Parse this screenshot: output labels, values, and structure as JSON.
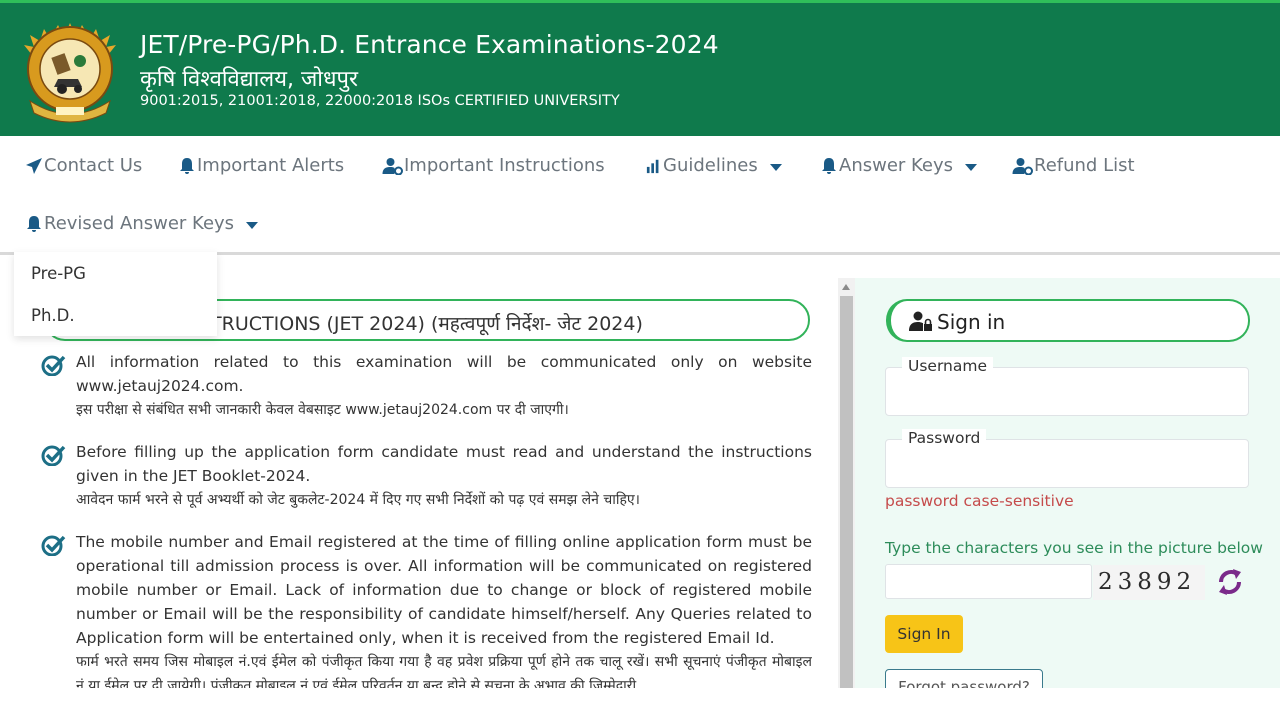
{
  "header": {
    "title": "JET/Pre-PG/Ph.D. Entrance Examinations-2024",
    "subtitle": "कृषि विश्वविद्यालय, जोधपुर",
    "iso": "9001:2015, 21001:2018, 22000:2018 ISOs CERTIFIED UNIVERSITY"
  },
  "nav": {
    "items": [
      {
        "label": "Contact Us",
        "icon": "paper-plane-icon"
      },
      {
        "label": "Important Alerts",
        "icon": "bell-icon"
      },
      {
        "label": "Important Instructions",
        "icon": "user-gear-icon"
      },
      {
        "label": "Guidelines",
        "icon": "bar-chart-icon"
      },
      {
        "label": "Answer Keys",
        "icon": "bell-icon"
      },
      {
        "label": "Refund List",
        "icon": "user-gear-icon"
      },
      {
        "label": "Revised Answer Keys",
        "icon": "bell-icon"
      }
    ],
    "dropdown": [
      "Pre-PG",
      "Ph.D."
    ]
  },
  "instructions": {
    "heading": "STRUCTIONS (JET 2024) (महत्वपूर्ण निर्देश- जेट 2024)",
    "items": [
      {
        "en": "All information related to this examination will be communicated only on website www.jetauj2024.com.",
        "hi": "इस परीक्षा से संबंधित सभी जानकारी केवल वेबसाइट www.jetauj2024.com पर दी जाएगी।"
      },
      {
        "en": "Before filling up the application form candidate must read and understand the instructions given in the JET Booklet-2024.",
        "hi": "आवेदन फार्म भरने से पूर्व अभ्यर्थी को जेट बुकलेट-2024 में दिए गए सभी निर्देशों को पढ़ एवं समझ लेने चाहिए।"
      },
      {
        "en": "The mobile number and Email registered at the time of filling online application form must be operational till admission process is over. All information will be communicated on registered mobile number or Email. Lack of information due to change or block of registered mobile number or Email will be the responsibility of candidate himself/herself. Any Queries related to Application form will be entertained only, when it is received from the registered Email Id.",
        "hi": "फार्म भरते समय जिस मोबाइल नं.एवं ईमेल को पंजीकृत किया गया है वह प्रवेश प्रक्रिया पूर्ण होने तक चालू रखें। सभी सूचनाएं पंजीकृत मोबाइल नं.या ईमेल पर दी जायेगी। पंजीकृत मोबाइल नं.एवं ईमेल परिवर्तन या बन्द होने से सूचना के अभाव की जिम्मेदारी"
      }
    ]
  },
  "signin": {
    "heading": "Sign in",
    "username_label": "Username",
    "username_value": "",
    "password_label": "Password",
    "password_value": "",
    "password_note": "password case-sensitive",
    "captcha_prompt": "Type the characters you see in the picture below",
    "captcha_value": "",
    "captcha_text": "23892",
    "submit": "Sign In",
    "forgot": "Forgot password?"
  },
  "colors": {
    "header_bg": "#0f7a4c",
    "accent_green": "#32b35a",
    "nav_text": "#6c757d",
    "icon_blue": "#1a5a86",
    "warning_red": "#c54b4b",
    "button_yellow": "#f7c417",
    "side_bg": "#eefaf5"
  }
}
